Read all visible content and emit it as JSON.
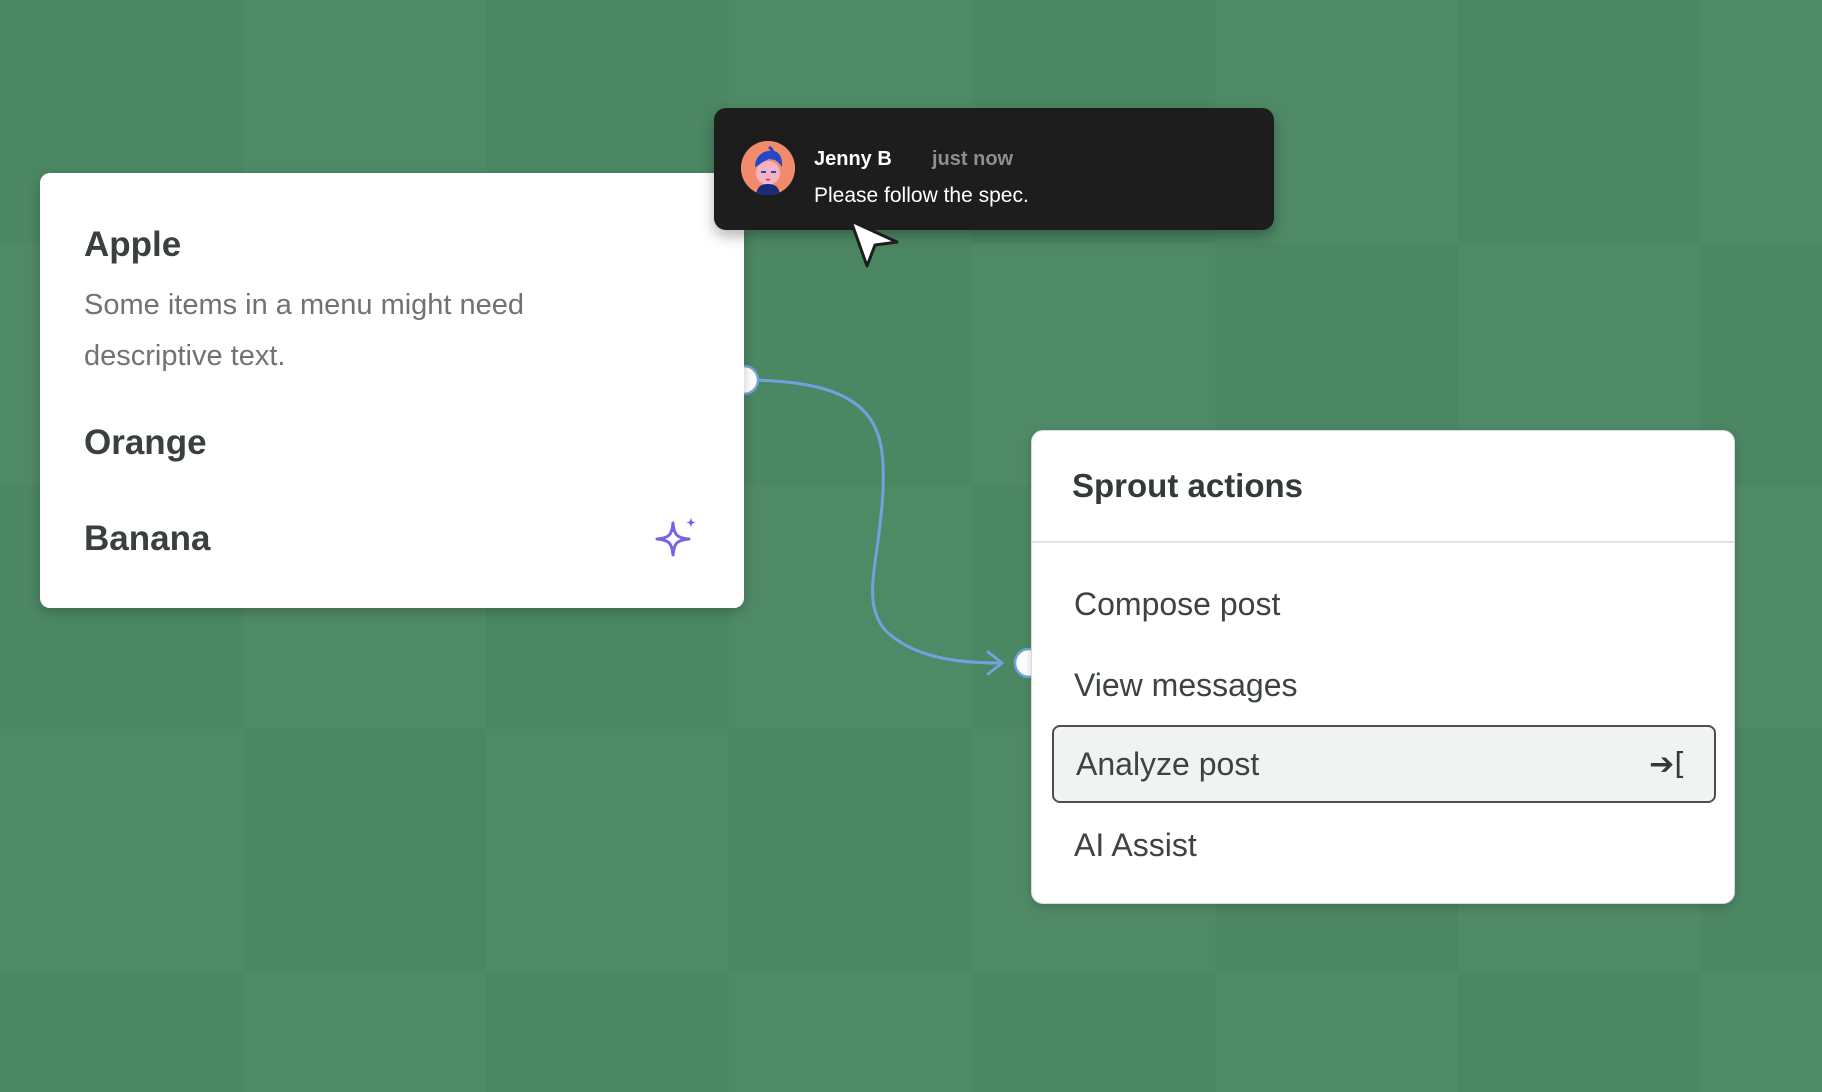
{
  "left_menu": {
    "items": [
      {
        "label": "Apple",
        "description": "Some items in a menu might need descriptive text."
      },
      {
        "label": "Orange"
      },
      {
        "label": "Banana",
        "icon": "sparkle-icon",
        "icon_color": "#7b61e0"
      }
    ]
  },
  "comment": {
    "author": "Jenny B",
    "time": "just now",
    "text": "Please follow the spec.",
    "avatar": "avatar-icon"
  },
  "sprout_menu": {
    "title": "Sprout actions",
    "items": [
      {
        "label": "Compose post"
      },
      {
        "label": "View messages"
      },
      {
        "label": "Analyze post",
        "selected": true,
        "shortcut": "➔["
      },
      {
        "label": "AI Assist"
      }
    ]
  },
  "colors": {
    "background": "#4b8763",
    "connector": "#6fa3e0",
    "comment_bg": "#1d1d1d"
  }
}
